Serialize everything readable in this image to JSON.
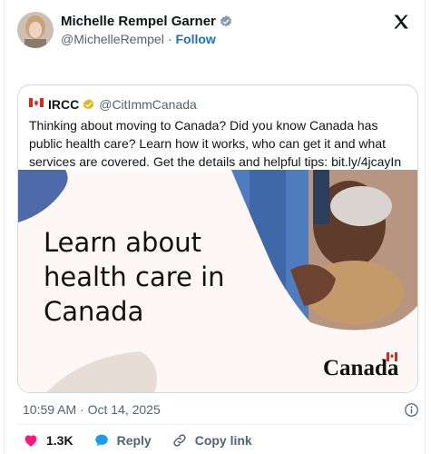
{
  "author": {
    "name": "Michelle Rempel Garner",
    "handle": "@MichelleRempel",
    "separator": "·",
    "follow_label": "Follow"
  },
  "quoted": {
    "name": "IRCC",
    "handle": "@CitImmCanada",
    "text": "Thinking about moving to Canada? Did you know Canada has public health care? Learn how it works, who can get it and what services are covered. Get the details and helpful tips: bit.ly/4jcayIn",
    "media": {
      "headline": "Learn about health care in Canada",
      "wordmark": "Canada"
    }
  },
  "timestamp": "10:59 AM · Oct 14, 2025",
  "actions": {
    "like_count": "1.3K",
    "reply_label": "Reply",
    "copy_link_label": "Copy link"
  },
  "colors": {
    "like": "#f91880",
    "reply": "#1d9bf0",
    "verified": "#e2b719",
    "link": "#1d6fbf"
  },
  "icons": [
    "verified-badge-icon",
    "x-logo-icon",
    "canada-flag-icon",
    "info-icon",
    "heart-icon",
    "reply-bubble-icon",
    "link-icon"
  ]
}
